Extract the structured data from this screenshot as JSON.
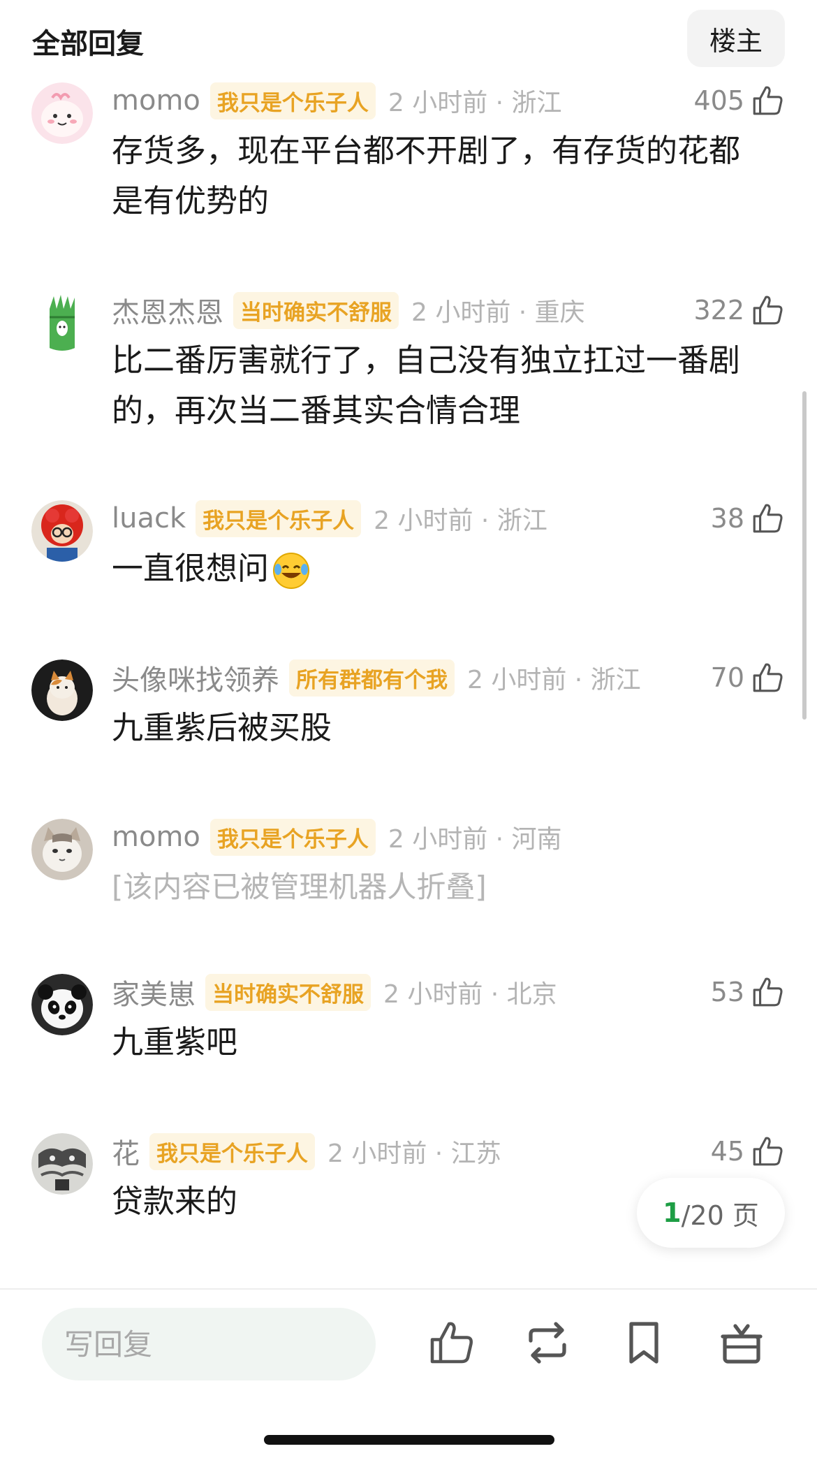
{
  "header": {
    "title": "全部回复",
    "op_label": "楼主"
  },
  "comments": [
    {
      "username": "momo",
      "badge": "我只是个乐子人",
      "time": "2 小时前 · 浙江",
      "likes": "405",
      "text": "存货多，现在平台都不开剧了，有存货的花都是有优势的"
    },
    {
      "username": "杰恩杰恩",
      "badge": "当时确实不舒服",
      "time": "2 小时前 · 重庆",
      "likes": "322",
      "text": "比二番厉害就行了，自己没有独立扛过一番剧的，再次当二番其实合情合理"
    },
    {
      "username": "luack",
      "badge": "我只是个乐子人",
      "time": "2 小时前 · 浙江",
      "likes": "38",
      "text": "一直很想问"
    },
    {
      "username": "头像咪找领养",
      "badge": "所有群都有个我",
      "time": "2 小时前 · 浙江",
      "likes": "70",
      "text": "九重紫后被买股"
    },
    {
      "username": "momo",
      "badge": "我只是个乐子人",
      "time": "2 小时前 · 河南",
      "likes": "",
      "text": "[该内容已被管理机器人折叠]"
    },
    {
      "username": "家美崽",
      "badge": "当时确实不舒服",
      "time": "2 小时前 · 北京",
      "likes": "53",
      "text": "九重紫吧"
    },
    {
      "username": "花",
      "badge": "我只是个乐子人",
      "time": "2 小时前 · 江苏",
      "likes": "45",
      "text": "贷款来的"
    }
  ],
  "pagination": {
    "current": "1",
    "suffix": "/20 页"
  },
  "bottom_bar": {
    "reply_placeholder": "写回复"
  },
  "colors": {
    "badge_text": "#e8a323",
    "badge_bg": "#fdf5e2",
    "accent_green": "#1e9e45"
  }
}
